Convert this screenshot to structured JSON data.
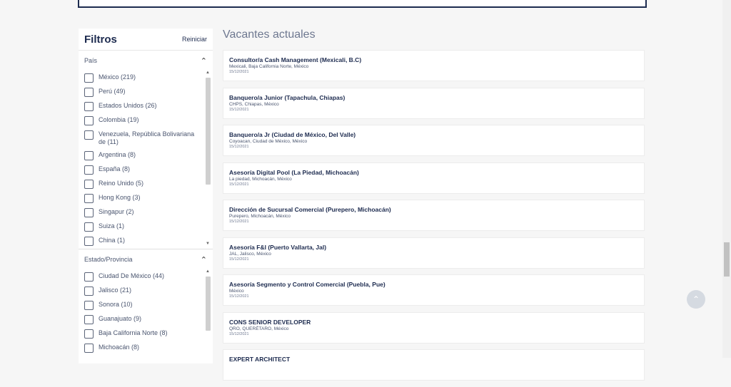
{
  "filters": {
    "title": "Filtros",
    "reset_label": "Reiniciar",
    "country": {
      "label": "País",
      "options": [
        "México (219)",
        "Perú (49)",
        "Estados Unidos (26)",
        "Colombia (19)",
        "Venezuela, República Bolivariana de (11)",
        "Argentina (8)",
        "España (8)",
        "Reino Unido (5)",
        "Hong Kong (3)",
        "Singapur (2)",
        "Suiza (1)",
        "China (1)"
      ]
    },
    "state": {
      "label": "Estado/Provincia",
      "options": [
        "Ciudad De México (44)",
        "Jalisco (21)",
        "Sonora (10)",
        "Guanajuato (9)",
        "Baja California Norte (8)",
        "Michoacán (8)"
      ]
    }
  },
  "jobs": {
    "title": "Vacantes actuales",
    "items": [
      {
        "title": "Consultor/a Cash Management (Mexicali, B.C)",
        "location": "Mexicali, Baja California Norte, México",
        "date": "15/12/2021"
      },
      {
        "title": "Banquero/a Junior (Tapachula, Chiapas)",
        "location": "CHPS, Chiapas, México",
        "date": "15/12/2021"
      },
      {
        "title": "Banquero/a Jr (Ciudad de México, Del Valle)",
        "location": "Coyoacan, Ciudad de México, México",
        "date": "15/12/2021"
      },
      {
        "title": "Asesoría Digital Pool (La Piedad, Michoacán)",
        "location": "La piedad, Michoacán, México",
        "date": "15/12/2021"
      },
      {
        "title": "Dirección de Sucursal Comercial (Purepero, Michoacán)",
        "location": "Purepero, Michoacán, México",
        "date": "15/12/2021"
      },
      {
        "title": "Asesoría F&I (Puerto Vallarta, Jal)",
        "location": "JAL, Jalisco, México",
        "date": "15/12/2021"
      },
      {
        "title": "Asesoría Segmento y Control Comercial (Puebla, Pue)",
        "location": "México",
        "date": "15/12/2021"
      },
      {
        "title": "CONS SENIOR DEVELOPER",
        "location": "QRO, QUERÉTARO, México",
        "date": "15/12/2021"
      },
      {
        "title": "EXPERT ARCHITECT",
        "location": "",
        "date": ""
      }
    ]
  }
}
